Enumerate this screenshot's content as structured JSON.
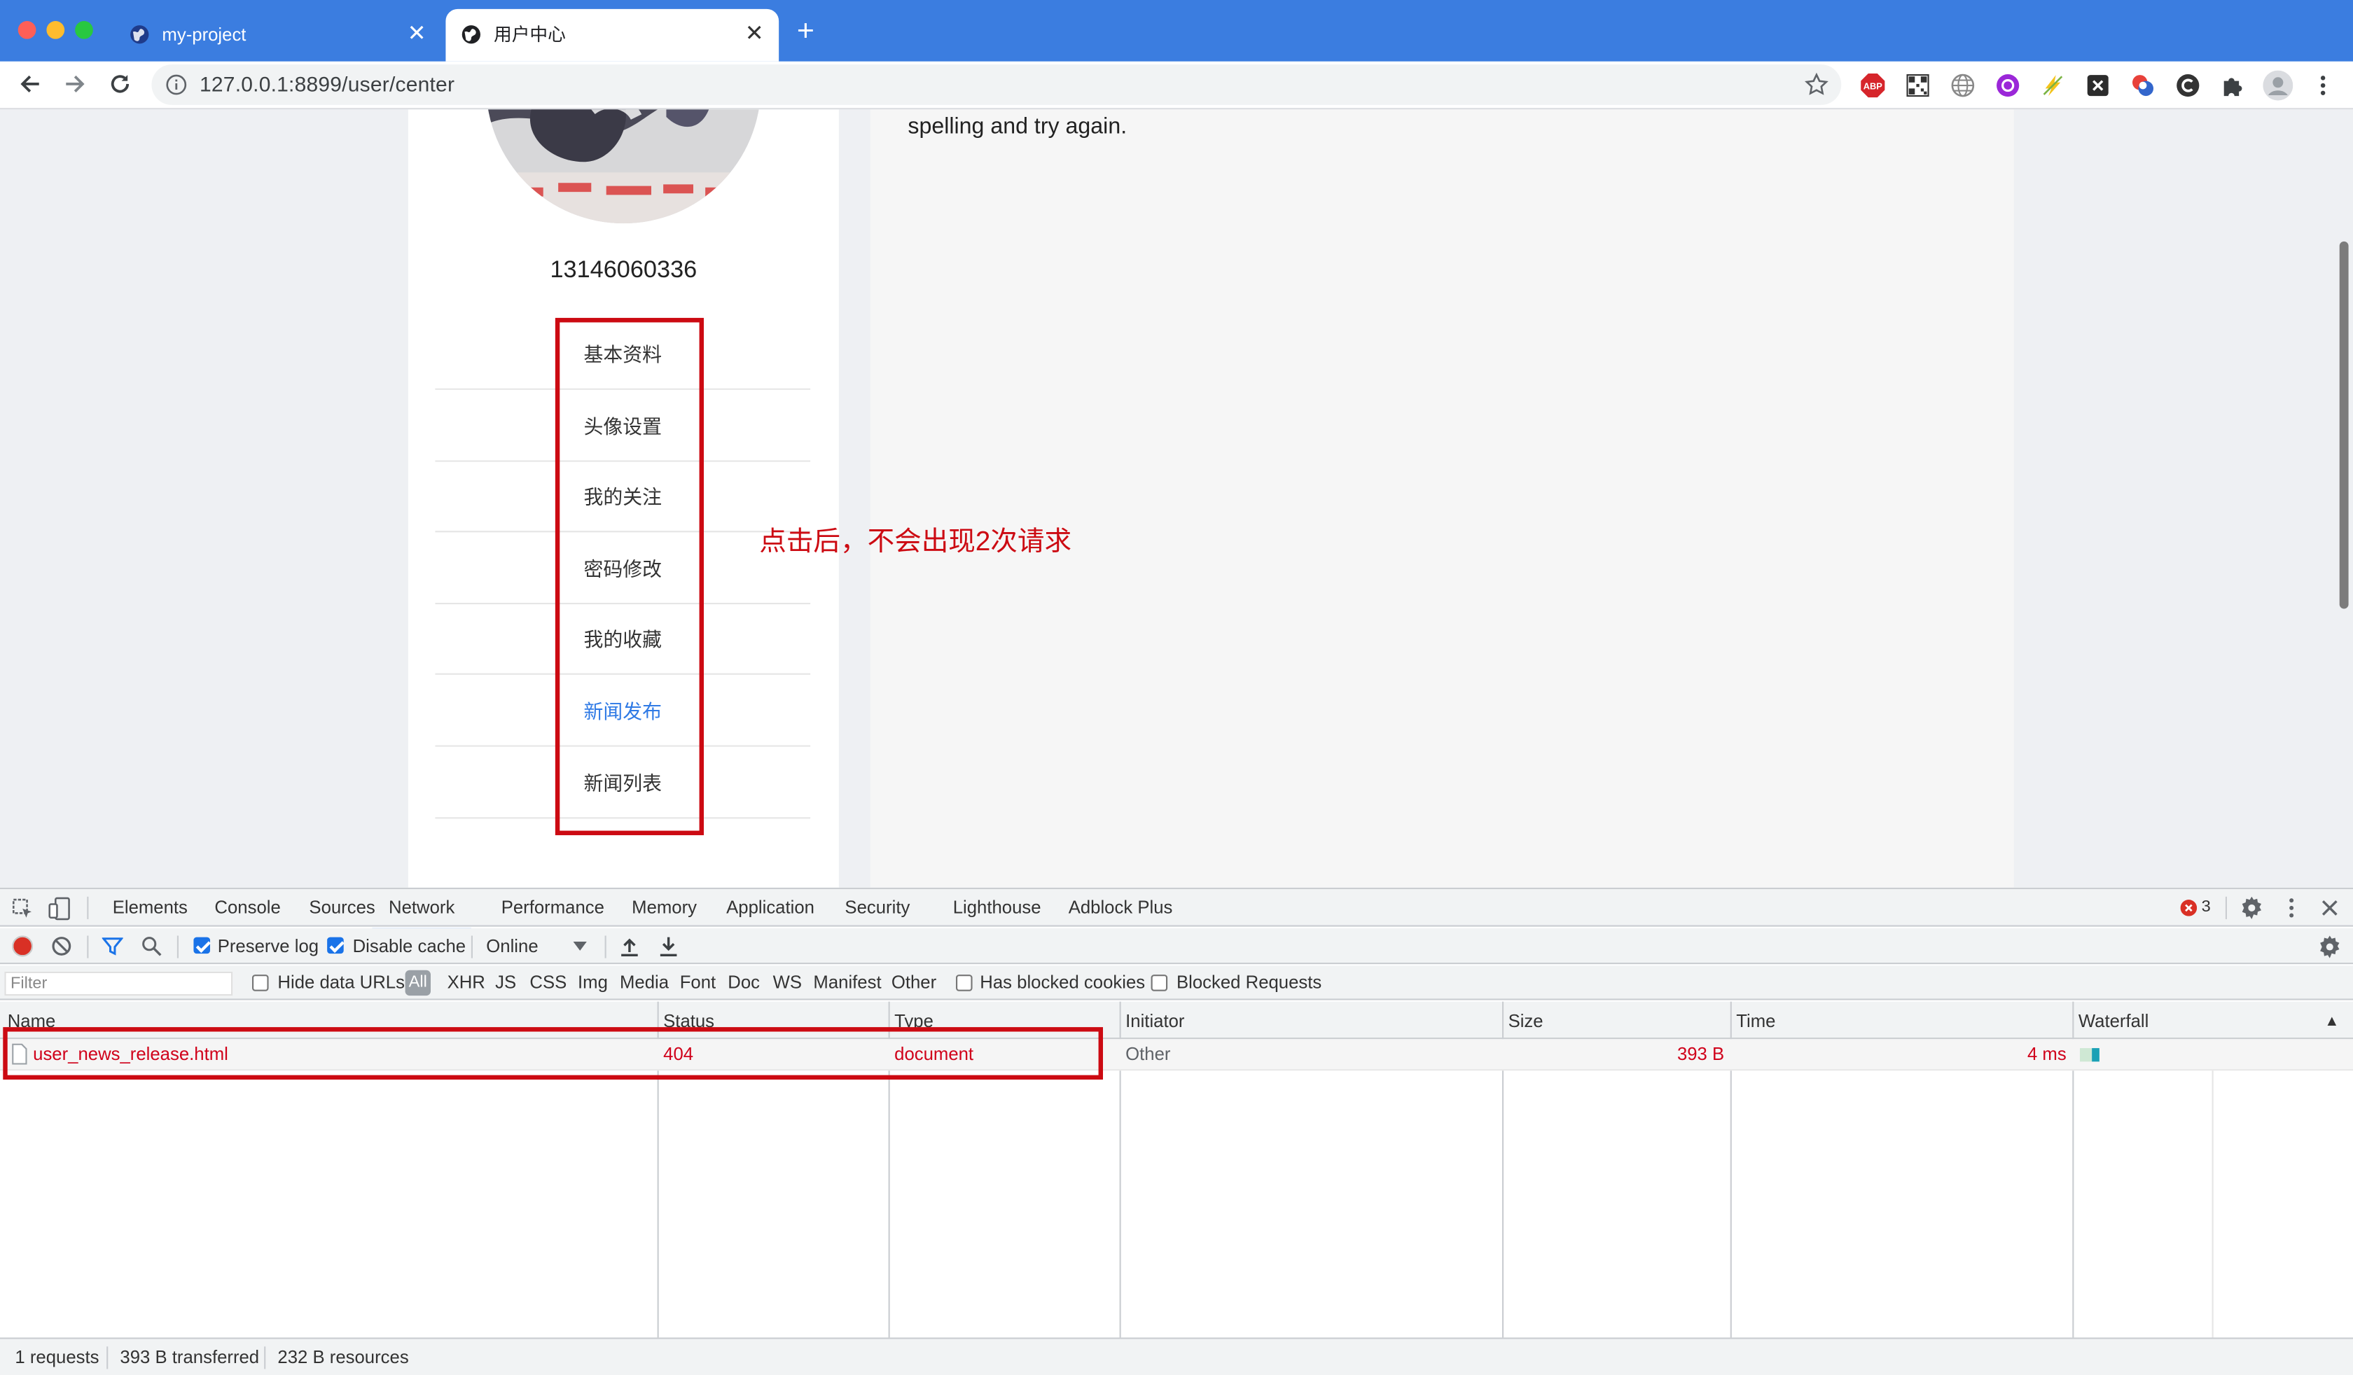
{
  "browser": {
    "tabs": [
      {
        "title": "my-project",
        "active": false
      },
      {
        "title": "用户中心",
        "active": true
      }
    ],
    "close_glyph": "✕",
    "new_tab_glyph": "+",
    "url": "127.0.0.1:8899/user/center",
    "extensions": [
      "adblock-plus-icon",
      "qr-code-icon",
      "globe-icon",
      "purple-extension-icon",
      "lightning-icon",
      "x-extension-icon",
      "translate-icon",
      "c-extension-icon",
      "puzzle-icon",
      "profile-avatar-icon",
      "kebab-menu-icon"
    ],
    "extension_labels": {
      "adblock": "ABP"
    },
    "colors": {
      "tab_strip": "#3b7de0",
      "active_menu": "#2f7ae5",
      "annotation": "#cc0a12"
    }
  },
  "page": {
    "username": "13146060336",
    "menu": [
      {
        "label": "基本资料",
        "active": false
      },
      {
        "label": "头像设置",
        "active": false
      },
      {
        "label": "我的关注",
        "active": false
      },
      {
        "label": "密码修改",
        "active": false
      },
      {
        "label": "我的收藏",
        "active": false
      },
      {
        "label": "新闻发布",
        "active": true
      },
      {
        "label": "新闻列表",
        "active": false
      }
    ],
    "error_text": "spelling and try again."
  },
  "annotation": "点击后，不会出现2次请求",
  "devtools": {
    "tabs": [
      "Elements",
      "Console",
      "Sources",
      "Network",
      "Performance",
      "Memory",
      "Application",
      "Security",
      "Lighthouse",
      "Adblock Plus"
    ],
    "active_tab": "Network",
    "error_count": "3",
    "toolbar": {
      "preserve_log": "Preserve log",
      "preserve_log_checked": true,
      "disable_cache": "Disable cache",
      "disable_cache_checked": true,
      "throttling": "Online"
    },
    "filter": {
      "placeholder": "Filter",
      "hide_data_urls": "Hide data URLs",
      "types": [
        "All",
        "XHR",
        "JS",
        "CSS",
        "Img",
        "Media",
        "Font",
        "Doc",
        "WS",
        "Manifest",
        "Other"
      ],
      "has_blocked_cookies": "Has blocked cookies",
      "blocked_requests": "Blocked Requests"
    },
    "columns": [
      "Name",
      "Status",
      "Type",
      "Initiator",
      "Size",
      "Time",
      "Waterfall"
    ],
    "sort_indicator": "▲",
    "rows": [
      {
        "name": "user_news_release.html",
        "status": "404",
        "type": "document",
        "initiator": "Other",
        "size": "393 B",
        "time": "4 ms"
      }
    ],
    "status_bar": [
      "1 requests",
      "393 B transferred",
      "232 B resources"
    ]
  }
}
